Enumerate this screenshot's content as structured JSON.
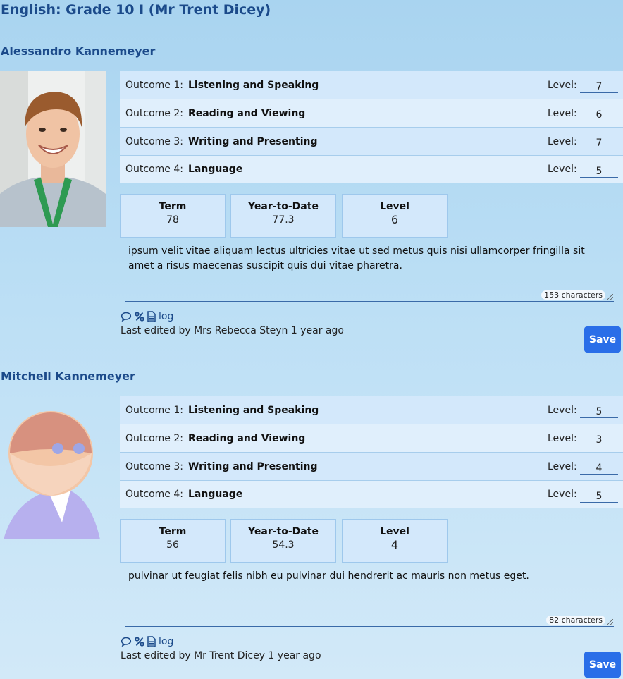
{
  "course_title": "English: Grade 10 I (Mr Trent Dicey)",
  "students": [
    {
      "name": "Alessandro Kannemeyer",
      "outcomes": [
        {
          "label": "Outcome 1:",
          "name": "Listening and Speaking",
          "level_label": "Level:",
          "level": "7"
        },
        {
          "label": "Outcome 2:",
          "name": "Reading and Viewing",
          "level_label": "Level:",
          "level": "6"
        },
        {
          "label": "Outcome 3:",
          "name": "Writing and Presenting",
          "level_label": "Level:",
          "level": "7"
        },
        {
          "label": "Outcome 4:",
          "name": "Language",
          "level_label": "Level:",
          "level": "5"
        }
      ],
      "summary": {
        "term_label": "Term",
        "term": "78",
        "ytd_label": "Year-to-Date",
        "ytd": "77.3",
        "level_label": "Level",
        "level": "6"
      },
      "comment": "ipsum velit vitae aliquam lectus ultricies vitae ut sed metus quis nisi ullamcorper fringilla sit amet a risus maecenas suscipit quis dui vitae pharetra.",
      "char_count": "153 characters",
      "log_label": "log",
      "last_edited": "Last edited by Mrs Rebecca Steyn 1 year ago",
      "save_label": "Save"
    },
    {
      "name": "Mitchell Kannemeyer",
      "outcomes": [
        {
          "label": "Outcome 1:",
          "name": "Listening and Speaking",
          "level_label": "Level:",
          "level": "5"
        },
        {
          "label": "Outcome 2:",
          "name": "Reading and Viewing",
          "level_label": "Level:",
          "level": "3"
        },
        {
          "label": "Outcome 3:",
          "name": "Writing and Presenting",
          "level_label": "Level:",
          "level": "4"
        },
        {
          "label": "Outcome 4:",
          "name": "Language",
          "level_label": "Level:",
          "level": "5"
        }
      ],
      "summary": {
        "term_label": "Term",
        "term": "56",
        "ytd_label": "Year-to-Date",
        "ytd": "54.3",
        "level_label": "Level",
        "level": "4"
      },
      "comment": "pulvinar ut feugiat felis nibh eu pulvinar dui hendrerit ac mauris non metus eget.",
      "char_count": "82 characters",
      "log_label": "log",
      "last_edited": "Last edited by Mr Trent Dicey 1 year ago",
      "save_label": "Save"
    }
  ],
  "colors": {
    "heading": "#1b4a8a",
    "save_button": "#2a6ee8"
  },
  "icons": [
    "comment-icon",
    "percent-icon",
    "document-icon",
    "avatar-placeholder-icon"
  ]
}
